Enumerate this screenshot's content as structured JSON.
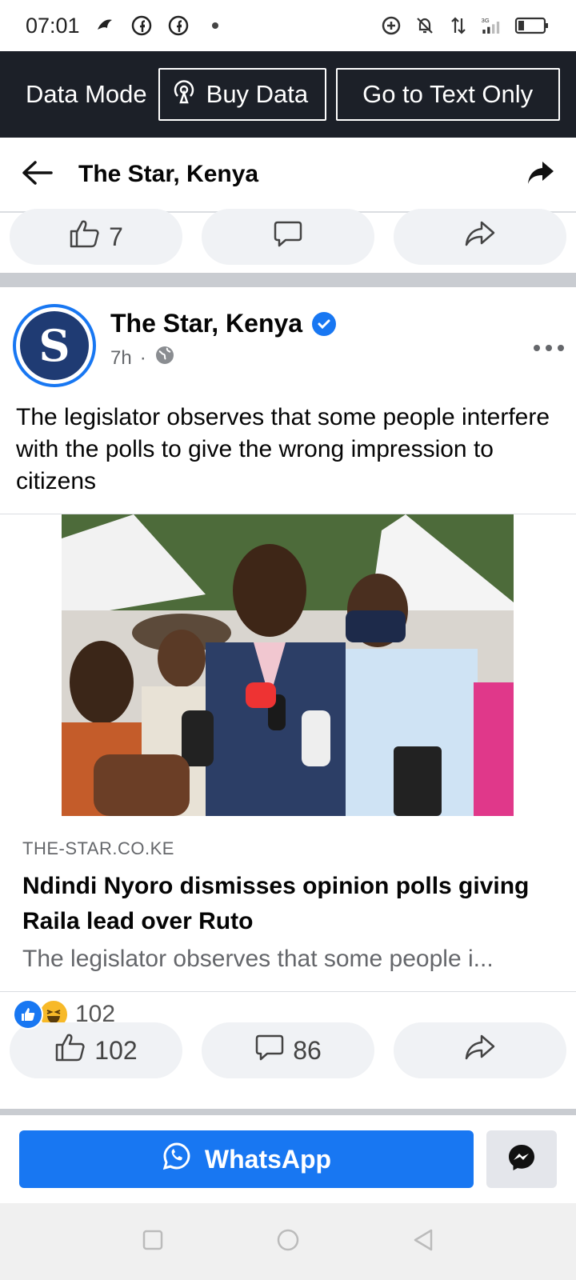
{
  "status_bar": {
    "time": "07:01",
    "icons_left": [
      "bird-icon",
      "facebook-icon",
      "facebook-icon",
      "dot-icon"
    ],
    "icons_right": [
      "data-saver-icon",
      "bell-off-icon",
      "data-arrows-icon",
      "signal-3g-icon",
      "battery-icon"
    ],
    "network": "3G"
  },
  "data_bar": {
    "label": "Data Mode",
    "buy_label": "Buy Data",
    "text_only_label": "Go to Text Only"
  },
  "header": {
    "title": "The Star, Kenya"
  },
  "prev_post_actions": {
    "like_count": "7"
  },
  "post": {
    "page_name": "The Star, Kenya",
    "time": "7h",
    "avatar_letter": "S",
    "text": "The legislator observes that some people interfere with the polls to give the wrong impression to citizens",
    "image_alt": "Man in suit speaking into microphones surrounded by people",
    "link": {
      "domain": "THE-STAR.CO.KE",
      "title": "Ndindi Nyoro dismisses opinion polls giving Raila lead over Ruto",
      "description": "The legislator observes that some people i..."
    },
    "reaction_count": "102",
    "like_count": "102",
    "comment_count": "86"
  },
  "share_bar": {
    "whatsapp_label": "WhatsApp"
  },
  "colors": {
    "accent": "#1877f2",
    "dark_bar": "#1c2028",
    "pill_bg": "#f0f2f5"
  }
}
